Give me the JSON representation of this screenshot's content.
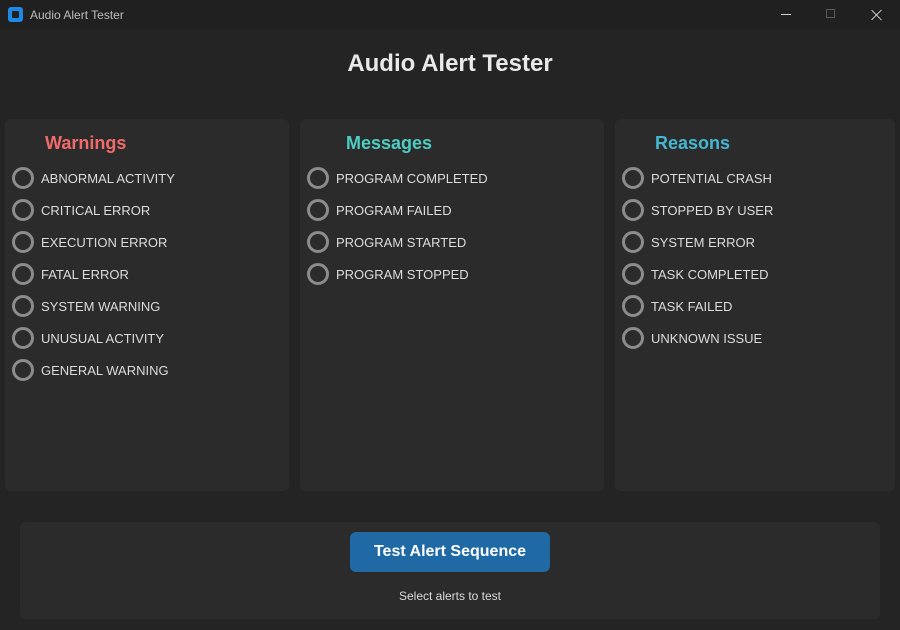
{
  "window": {
    "title": "Audio Alert Tester"
  },
  "header": {
    "title": "Audio Alert Tester"
  },
  "colors": {
    "background": "#242424",
    "panel": "#2b2b2b",
    "warnings_heading": "#f26b6b",
    "messages_heading": "#4ecdc4",
    "reasons_heading": "#45b7d1",
    "button": "#1f6aa5"
  },
  "warnings": {
    "heading": "Warnings",
    "items": [
      {
        "label": "ABNORMAL ACTIVITY",
        "selected": false
      },
      {
        "label": "CRITICAL ERROR",
        "selected": false
      },
      {
        "label": "EXECUTION ERROR",
        "selected": false
      },
      {
        "label": "FATAL ERROR",
        "selected": false
      },
      {
        "label": "SYSTEM WARNING",
        "selected": false
      },
      {
        "label": "UNUSUAL ACTIVITY",
        "selected": false
      },
      {
        "label": "GENERAL WARNING",
        "selected": false
      }
    ]
  },
  "messages": {
    "heading": "Messages",
    "items": [
      {
        "label": "PROGRAM COMPLETED",
        "selected": false
      },
      {
        "label": "PROGRAM FAILED",
        "selected": false
      },
      {
        "label": "PROGRAM STARTED",
        "selected": false
      },
      {
        "label": "PROGRAM STOPPED",
        "selected": false
      }
    ]
  },
  "reasons": {
    "heading": "Reasons",
    "items": [
      {
        "label": "POTENTIAL CRASH",
        "selected": false
      },
      {
        "label": "STOPPED BY USER",
        "selected": false
      },
      {
        "label": "SYSTEM ERROR",
        "selected": false
      },
      {
        "label": "TASK COMPLETED",
        "selected": false
      },
      {
        "label": "TASK FAILED",
        "selected": false
      },
      {
        "label": "UNKNOWN ISSUE",
        "selected": false
      }
    ]
  },
  "footer": {
    "button_label": "Test Alert Sequence",
    "status": "Select alerts to test"
  }
}
